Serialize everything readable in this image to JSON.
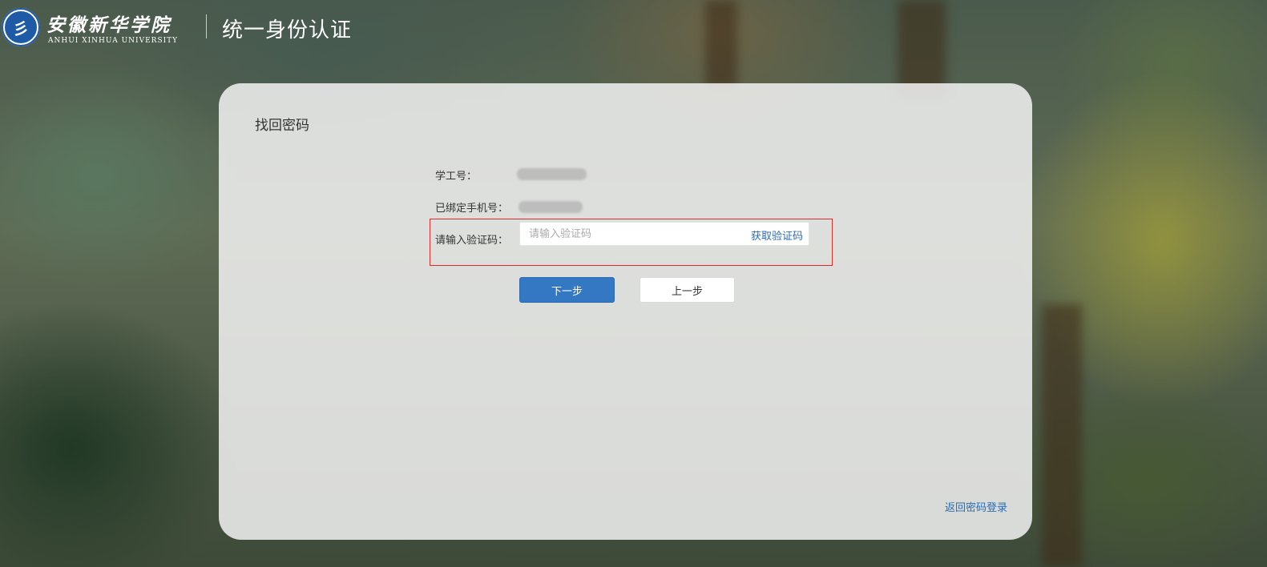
{
  "header": {
    "logo_seal_glyph": "彡",
    "logo_cn": "安徽新华学院",
    "logo_en": "ANHUI XINHUA UNIVERSITY",
    "title": "统一身份认证"
  },
  "card": {
    "title": "找回密码",
    "fields": {
      "student_id_label": "学工号：",
      "phone_label": "已绑定手机号：",
      "code_label": "请输入验证码："
    },
    "code_input": {
      "value": "",
      "placeholder": "请输入验证码"
    },
    "get_code_label": "获取验证码",
    "next_button": "下一步",
    "prev_button": "上一步",
    "back_link": "返回密码登录"
  },
  "colors": {
    "accent": "#3478c4",
    "link": "#2a6cb5",
    "highlight_border": "#e02b2b"
  }
}
